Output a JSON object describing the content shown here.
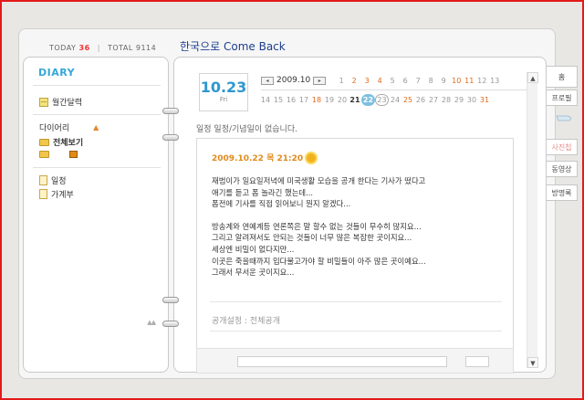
{
  "header": {
    "today_label": "TODAY",
    "today_count": "36",
    "total_label": "TOTAL",
    "total_count": "9114",
    "title": "한국으로 Come Back"
  },
  "sidebar": {
    "title": "DIARY",
    "monthly_calendar": "월간달력",
    "diary_section": "다이어리",
    "all_view": "전체보기",
    "schedule": "일정",
    "ledger": "가계부",
    "scroll_arrows": "▲▲"
  },
  "calendar": {
    "date_big": "10.23",
    "day_of_week": "Fri",
    "month_label": "2009.10",
    "prev_icon": "◂",
    "next_icon": "▸",
    "row1": [
      "1",
      "2",
      "3",
      "4",
      "5",
      "6",
      "7",
      "8",
      "9",
      "10",
      "11",
      "12",
      "13"
    ],
    "row2": [
      "14",
      "15",
      "16",
      "17",
      "18",
      "19",
      "20",
      "21",
      "22",
      "23",
      "24",
      "25",
      "26",
      "27",
      "28",
      "29",
      "30",
      "31"
    ]
  },
  "schedule_text": "일정 일정/기념일이 없습니다.",
  "post": {
    "date": "2009.10.22 목 21:20",
    "weather_icon": "sun-icon",
    "lines": [
      "재범이가 일요일저녁에 미국생활 모습을 공개 한다는 기사가 떴다고",
      "애기를 듣고 폼 놀라긴 했는데...",
      "폼전에 기사를 직접 읽어보니 뭔지 알겠다...",
      "",
      "방송계와 연예계등 연론쪽은 말 할수 없는 것들이 무수히 많지요...",
      "그리고 알려져서도 안되는 것들이 너무 많은 복잡한 곳이지요...",
      "세상엔 비밀이 없다지만...",
      "이곳은 죽을때까지 입다물고가야 할 비밀들이 아주 많은 곳이예요...",
      "그래서 무서운 곳이지요..."
    ],
    "visibility": "공개설정 : 전체공개"
  },
  "tabs": [
    "홈",
    "프로필",
    "사진첩",
    "동영상",
    "방명록"
  ],
  "colors": {
    "accent_blue": "#2e97d1",
    "orange": "#e06a1a",
    "border_red": "#e31b1b"
  }
}
